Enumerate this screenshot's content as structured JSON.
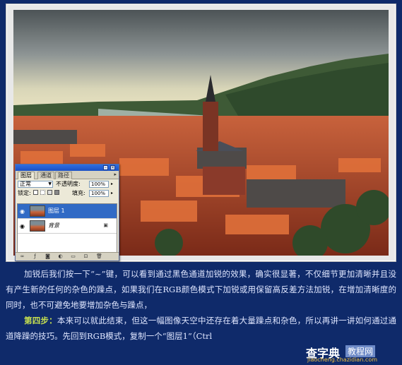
{
  "photo": {
    "subject": ""
  },
  "layers_panel": {
    "tabs": [
      "图层",
      "通道",
      "路径"
    ],
    "blend_mode": "正常",
    "opacity_label": "不透明度:",
    "opacity_value": "100%",
    "lock_label": "锁定:",
    "fill_label": "填充:",
    "fill_value": "100%",
    "layers": [
      {
        "name": "图层 1",
        "selected": true
      },
      {
        "name": "背景",
        "selected": false
      }
    ]
  },
  "article": {
    "paragraph1": "加锐后我们按一下“~”键，可以看到通过黑色通道加锐的效果，确实很显著，不仅细节更加清晰并且没有产生新的任何的杂色的躁点，如果我们在RGB颜色模式下加锐或用保留高反差方法加锐，在增加清晰度的同时，也不可避免地要增加杂色与躁点，",
    "step_label": "第四步：",
    "paragraph2": "本来可以就此结束，但这一幅图像天空中还存在着大量躁点和杂色，所以再讲一讲如何通过通道降躁的技巧。先回到RGB模式，复制一个“图层1”（Ctrl"
  },
  "watermark": {
    "main": "查字典",
    "tag": "教程网",
    "url": "jiaocheng.chazidian.com"
  }
}
